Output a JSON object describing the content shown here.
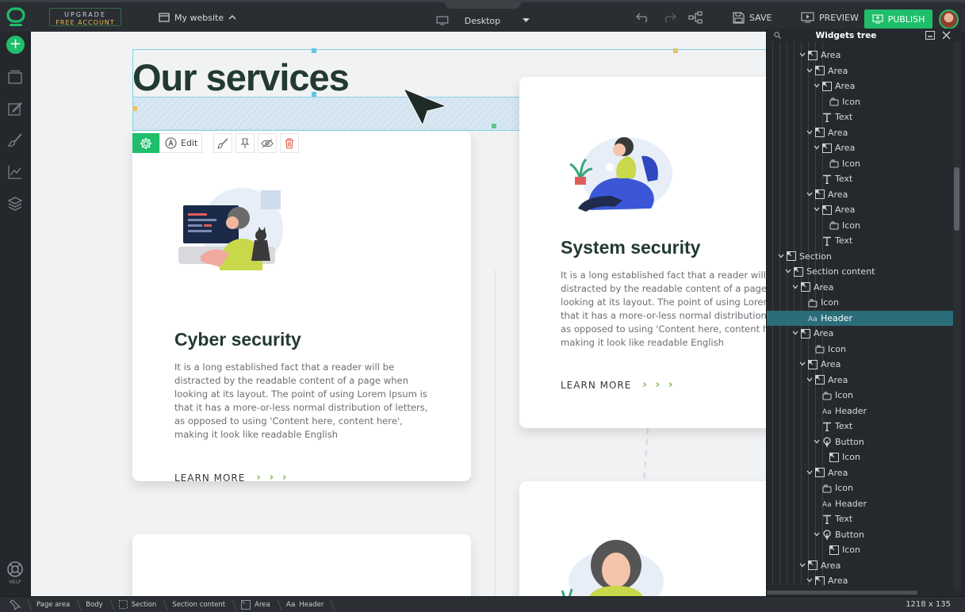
{
  "topbar": {
    "upgrade_line1": "UPGRADE",
    "upgrade_line2": "FREE ACCOUNT",
    "site_name": "My website",
    "device": "Desktop",
    "save": "SAVE",
    "preview": "PREVIEW",
    "publish": "PUBLISH"
  },
  "leftbar": {
    "help": "HELP"
  },
  "canvas": {
    "heading": "Our services",
    "toolbar": {
      "edit": "Edit"
    },
    "cards": [
      {
        "title": "Cyber security",
        "text": "It is a long established fact that a reader will be distracted by the readable content of a page when looking at its layout. The point of using Lorem Ipsum is that it has a more-or-less normal distribution of letters, as opposed to using 'Content here, content here', making it look like readable English",
        "link": "LEARN MORE"
      },
      {
        "title": "System security",
        "text": "It is a long established fact that a reader will be distracted by the readable content of a page when looking at its layout. The point of using Lorem Ipsum is that it has a more-or-less normal distribution of letters, as opposed to using 'Content here, content here', making it look like readable English",
        "link": "LEARN MORE"
      }
    ]
  },
  "panel": {
    "title": "Widgets tree",
    "rows": [
      {
        "label": "Area",
        "type": "area",
        "depth": 4,
        "exp": true
      },
      {
        "label": "Area",
        "type": "area",
        "depth": 5,
        "exp": true
      },
      {
        "label": "Area",
        "type": "area",
        "depth": 6,
        "exp": true
      },
      {
        "label": "Icon",
        "type": "icon",
        "depth": 7,
        "exp": false
      },
      {
        "label": "Text",
        "type": "text",
        "depth": 6,
        "exp": false
      },
      {
        "label": "Area",
        "type": "area",
        "depth": 5,
        "exp": true
      },
      {
        "label": "Area",
        "type": "area",
        "depth": 6,
        "exp": true
      },
      {
        "label": "Icon",
        "type": "icon",
        "depth": 7,
        "exp": false
      },
      {
        "label": "Text",
        "type": "text",
        "depth": 6,
        "exp": false
      },
      {
        "label": "Area",
        "type": "area",
        "depth": 5,
        "exp": true
      },
      {
        "label": "Area",
        "type": "area",
        "depth": 6,
        "exp": true
      },
      {
        "label": "Icon",
        "type": "icon",
        "depth": 7,
        "exp": false
      },
      {
        "label": "Text",
        "type": "text",
        "depth": 6,
        "exp": false
      },
      {
        "label": "Section",
        "type": "area",
        "depth": 1,
        "exp": true
      },
      {
        "label": "Section content",
        "type": "area",
        "depth": 2,
        "exp": true
      },
      {
        "label": "Area",
        "type": "area",
        "depth": 3,
        "exp": true
      },
      {
        "label": "Icon",
        "type": "icon",
        "depth": 4,
        "exp": false
      },
      {
        "label": "Header",
        "type": "header",
        "depth": 4,
        "exp": false,
        "selected": true
      },
      {
        "label": "Area",
        "type": "area",
        "depth": 3,
        "exp": true
      },
      {
        "label": "Icon",
        "type": "icon",
        "depth": 5,
        "exp": false
      },
      {
        "label": "Area",
        "type": "area",
        "depth": 4,
        "exp": true
      },
      {
        "label": "Area",
        "type": "area",
        "depth": 5,
        "exp": true
      },
      {
        "label": "Icon",
        "type": "icon",
        "depth": 6,
        "exp": false
      },
      {
        "label": "Header",
        "type": "header",
        "depth": 6,
        "exp": false
      },
      {
        "label": "Text",
        "type": "text",
        "depth": 6,
        "exp": false
      },
      {
        "label": "Button",
        "type": "button",
        "depth": 6,
        "exp": true
      },
      {
        "label": "Icon",
        "type": "area",
        "depth": 7,
        "exp": false
      },
      {
        "label": "Area",
        "type": "area",
        "depth": 5,
        "exp": true
      },
      {
        "label": "Icon",
        "type": "icon",
        "depth": 6,
        "exp": false
      },
      {
        "label": "Header",
        "type": "header",
        "depth": 6,
        "exp": false
      },
      {
        "label": "Text",
        "type": "text",
        "depth": 6,
        "exp": false
      },
      {
        "label": "Button",
        "type": "button",
        "depth": 6,
        "exp": true
      },
      {
        "label": "Icon",
        "type": "area",
        "depth": 7,
        "exp": false
      },
      {
        "label": "Area",
        "type": "area",
        "depth": 4,
        "exp": true
      },
      {
        "label": "Area",
        "type": "area",
        "depth": 5,
        "exp": true
      }
    ]
  },
  "breadcrumbs": [
    "Page area",
    "Body",
    "Section",
    "Section content",
    "Area",
    "Header"
  ],
  "dimensions": "1218 x 135",
  "colors": {
    "accent": "#1fbe6a",
    "selection": "#2b6e7a",
    "heading": "#223a32",
    "chevron": "#7cb342"
  }
}
